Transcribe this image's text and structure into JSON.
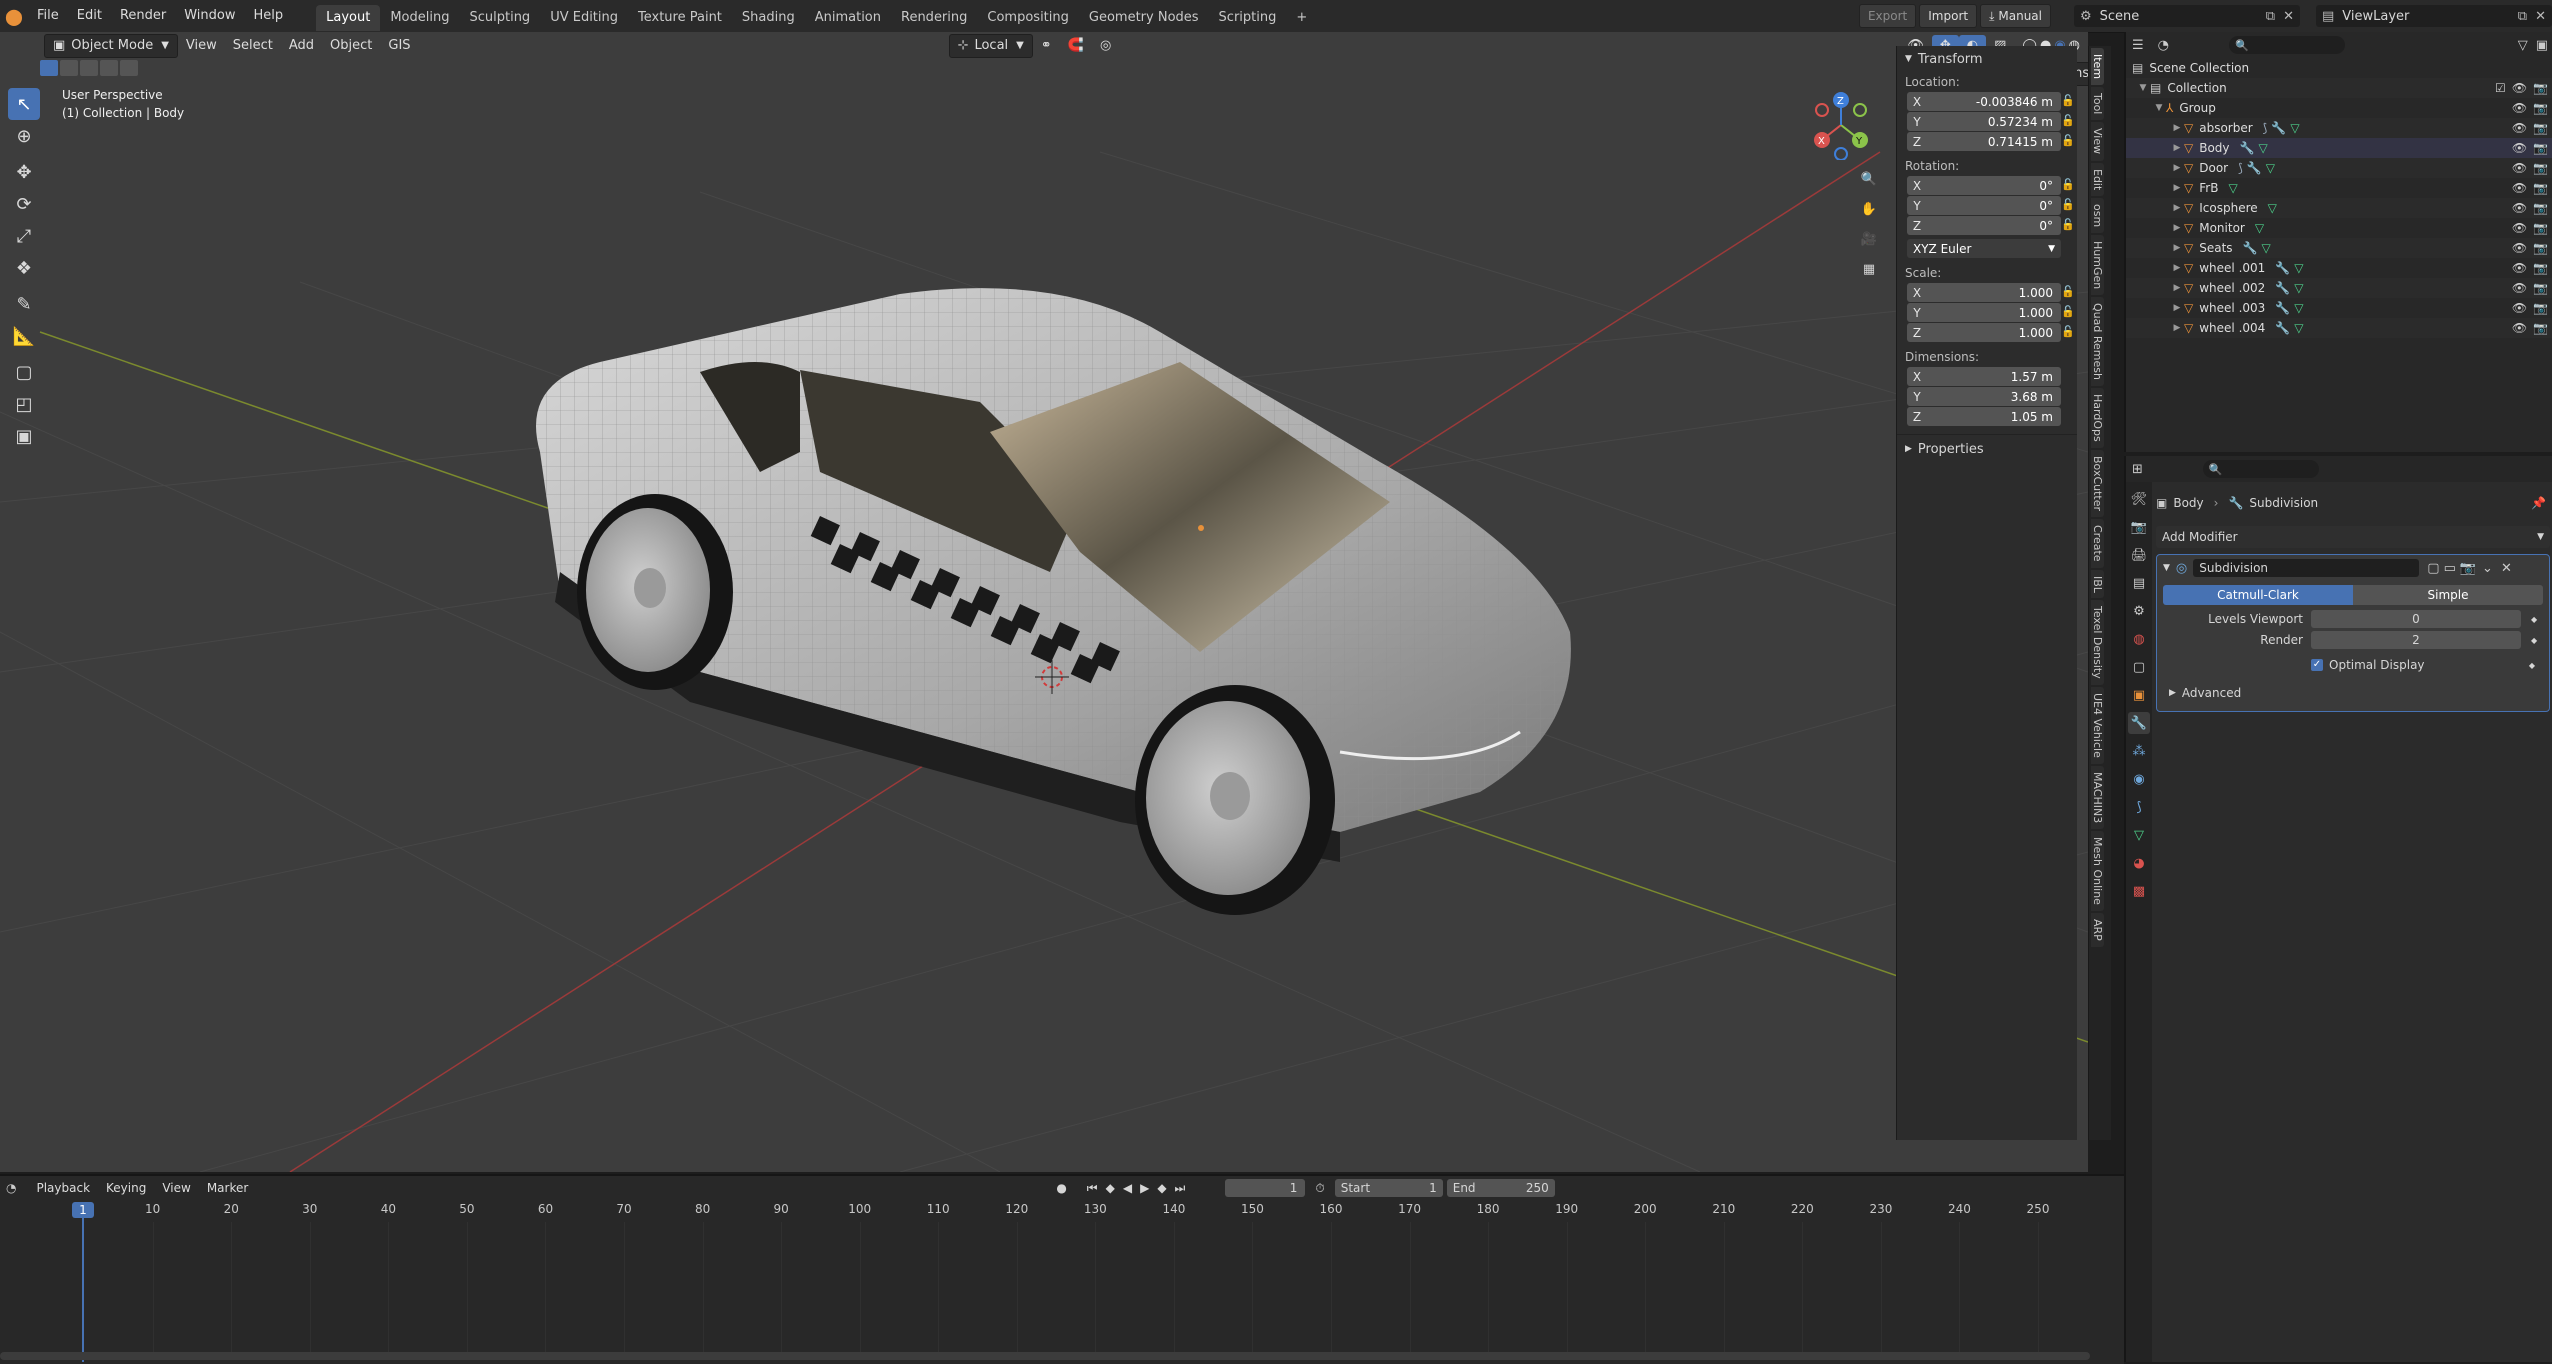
{
  "topbar": {
    "menus": [
      "File",
      "Edit",
      "Render",
      "Window",
      "Help"
    ],
    "workspaces": [
      "Layout",
      "Modeling",
      "Sculpting",
      "UV Editing",
      "Texture Paint",
      "Shading",
      "Animation",
      "Rendering",
      "Compositing",
      "Geometry Nodes",
      "Scripting"
    ],
    "add_tab": "+",
    "export_label": "Export",
    "import_label": "Import",
    "manual_label": "Manual",
    "scene_label": "Scene",
    "viewlayer_label": "ViewLayer"
  },
  "viewport": {
    "mode_label": "Object Mode",
    "menus": [
      "View",
      "Select",
      "Add",
      "Object"
    ],
    "gis_label": "GIS",
    "orientation_label": "Local",
    "options_label": "Options",
    "view_name": "User Perspective",
    "collection_info": "(1) Collection | Body",
    "gizmo_axes": [
      "X",
      "Y",
      "Z"
    ]
  },
  "npanel": {
    "transform_title": "Transform",
    "location_label": "Location:",
    "location": [
      {
        "axis": "X",
        "value": "-0.003846 m"
      },
      {
        "axis": "Y",
        "value": "0.57234 m"
      },
      {
        "axis": "Z",
        "value": "0.71415 m"
      }
    ],
    "rotation_label": "Rotation:",
    "rotation": [
      {
        "axis": "X",
        "value": "0°"
      },
      {
        "axis": "Y",
        "value": "0°"
      },
      {
        "axis": "Z",
        "value": "0°"
      }
    ],
    "rotation_mode": "XYZ Euler",
    "scale_label": "Scale:",
    "scale": [
      {
        "axis": "X",
        "value": "1.000"
      },
      {
        "axis": "Y",
        "value": "1.000"
      },
      {
        "axis": "Z",
        "value": "1.000"
      }
    ],
    "dimensions_label": "Dimensions:",
    "dimensions": [
      {
        "axis": "X",
        "value": "1.57 m"
      },
      {
        "axis": "Y",
        "value": "3.68 m"
      },
      {
        "axis": "Z",
        "value": "1.05 m"
      }
    ],
    "properties_label": "Properties"
  },
  "sidetabs": [
    "Item",
    "Tool",
    "View",
    "Edit",
    "osm",
    "HumGen",
    "Quad Remesh",
    "HardOps",
    "BoxCutter",
    "Create",
    "IBL",
    "Texel Density",
    "UE4 Vehicle",
    "MACHIN3",
    "Mesh Online",
    "ARP"
  ],
  "outliner": {
    "scene_collection": "Scene Collection",
    "collection": "Collection",
    "group": "Group",
    "items": [
      "absorber",
      "Body",
      "Door",
      "FrB",
      "Icosphere",
      "Monitor",
      "Seats",
      "wheel .001",
      "wheel .002",
      "wheel .003",
      "wheel .004"
    ]
  },
  "properties": {
    "breadcrumb_object": "Body",
    "breadcrumb_modifier": "Subdivision",
    "add_modifier_label": "Add Modifier",
    "modifier_name": "Subdivision",
    "catmull_label": "Catmull-Clark",
    "simple_label": "Simple",
    "levels_viewport_label": "Levels Viewport",
    "levels_viewport_value": "0",
    "render_label": "Render",
    "render_value": "2",
    "optimal_display_label": "Optimal Display",
    "advanced_label": "Advanced"
  },
  "timeline": {
    "menus": [
      "Playback",
      "Keying",
      "View",
      "Marker"
    ],
    "current_frame": "1",
    "start_label": "Start",
    "start_value": "1",
    "end_label": "End",
    "end_value": "250",
    "ticks": [
      "1",
      "10",
      "20",
      "30",
      "40",
      "50",
      "60",
      "70",
      "80",
      "90",
      "100",
      "110",
      "120",
      "130",
      "140",
      "150",
      "160",
      "170",
      "180",
      "190",
      "200",
      "210",
      "220",
      "230",
      "240",
      "250"
    ]
  },
  "colors": {
    "accent": "#4772b3",
    "object_orange": "#e8913a",
    "mesh_green": "#4cd08a",
    "modifier_blue": "#6fa8dc"
  }
}
